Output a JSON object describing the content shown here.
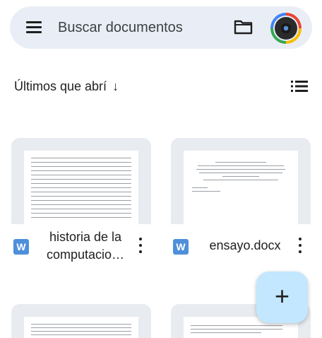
{
  "search": {
    "placeholder": "Buscar documentos"
  },
  "sort": {
    "label": "Últimos que abrí",
    "arrow": "↓"
  },
  "files": [
    {
      "name": "historia de la computacio…",
      "type_badge": "W"
    },
    {
      "name": "ensayo.docx",
      "type_badge": "W"
    }
  ],
  "fab": {
    "label": "+"
  },
  "icons": {
    "menu": "menu-icon",
    "folder": "folder-icon",
    "avatar": "avatar",
    "sort": "arrow-down-icon",
    "list_view": "list-view-icon",
    "word": "word-doc-icon",
    "more": "more-vert-icon",
    "fab": "plus-icon"
  },
  "colors": {
    "searchbar_bg": "#e9eef6",
    "word_blue": "#4e8fd9",
    "fab_bg": "#c2e7ff",
    "thumb_bg": "#e8ebf0"
  }
}
